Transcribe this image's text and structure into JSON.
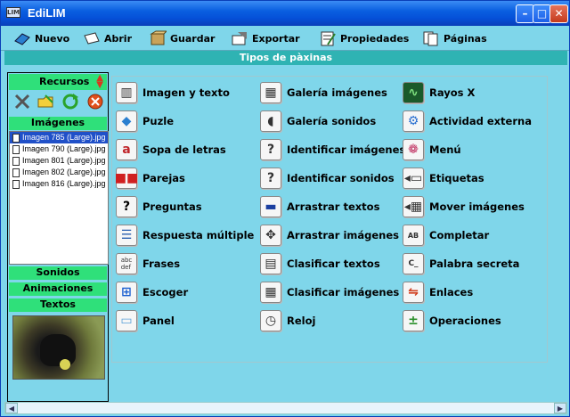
{
  "window": {
    "title": "EdiLIM",
    "app_icon_text": "LIM"
  },
  "toolbar": [
    {
      "label": "Nuevo",
      "icon": "new-icon"
    },
    {
      "label": "Abrir",
      "icon": "open-icon"
    },
    {
      "label": "Guardar",
      "icon": "save-icon"
    },
    {
      "label": "Exportar",
      "icon": "export-icon"
    },
    {
      "label": "Propiedades",
      "icon": "properties-icon"
    },
    {
      "label": "Páginas",
      "icon": "pages-icon"
    }
  ],
  "section_title": "Tipos de pàxinas",
  "left_panel": {
    "header": "Recursos",
    "categories": {
      "images": "Imágenes",
      "sounds": "Sonidos",
      "animations": "Animaciones",
      "texts": "Textos"
    },
    "files": [
      "Imagen 785 (Large).jpg",
      "Imagen 790 (Large).jpg",
      "Imagen 801 (Large).jpg",
      "Imagen 802 (Large).jpg",
      "Imagen 816 (Large).jpg"
    ],
    "selected_file_index": 0
  },
  "page_types": {
    "col1": [
      "Imagen y texto",
      "Puzle",
      "Sopa de letras",
      "Parejas",
      "Preguntas",
      "Respuesta múltiple",
      "Frases",
      "Escoger",
      "Panel"
    ],
    "col2": [
      "Galería imágenes",
      "Galería sonidos",
      "Identificar imágenes",
      "Identificar sonidos",
      "Arrastrar textos",
      "Arrastrar imágenes",
      "Clasificar textos",
      "Clasificar imágenes",
      "Reloj"
    ],
    "col3": [
      "Rayos X",
      "Actividad externa",
      "Menú",
      "Etiquetas",
      "Mover imágenes",
      "Completar",
      "Palabra secreta",
      "Enlaces",
      "Operaciones"
    ]
  },
  "colors": {
    "background": "#7fd6ea",
    "accent_green": "#2fe07a",
    "section_teal": "#2fb3b3"
  }
}
